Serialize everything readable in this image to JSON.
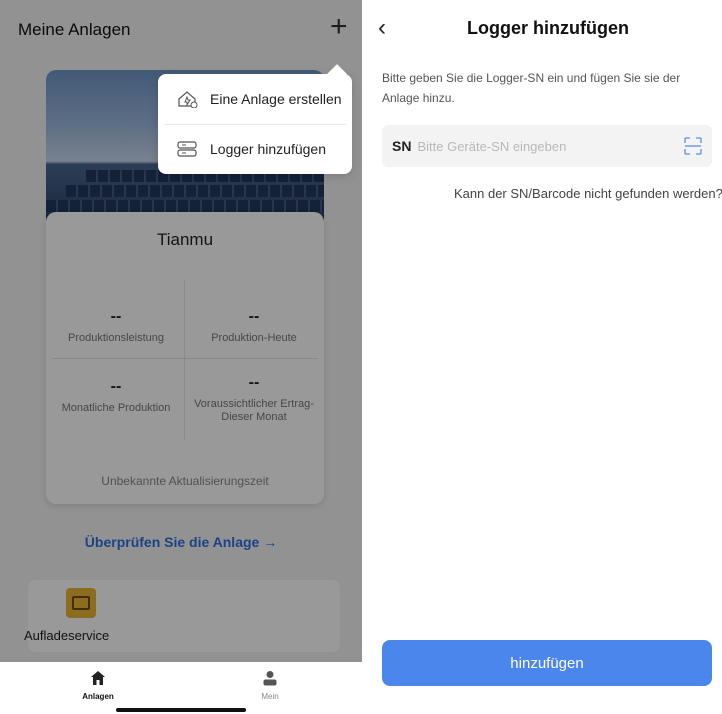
{
  "left": {
    "header_title": "Meine Anlagen",
    "plant_name": "Tianmu",
    "stats": [
      {
        "value": "--",
        "label": "Produktionsleistung"
      },
      {
        "value": "--",
        "label": "Produktion-Heute"
      },
      {
        "value": "--",
        "label": "Monatliche Produktion"
      },
      {
        "value": "--",
        "label": "Voraussichtlicher Ertrag-Dieser Monat"
      }
    ],
    "update_time": "Unbekannte Aktualisierungszeit",
    "check_link": "Überprüfen Sie die Anlage →",
    "service_label": "Aufladeservice",
    "tabs": [
      {
        "label": "Anlagen",
        "active": true
      },
      {
        "label": "Mein",
        "active": false
      }
    ],
    "popup": {
      "items": [
        {
          "label": "Eine Anlage erstellen",
          "icon": "house-add-icon"
        },
        {
          "label": "Logger hinzufügen",
          "icon": "logger-icon"
        }
      ]
    }
  },
  "right": {
    "title": "Logger hinzufügen",
    "description": "Bitte geben Sie die Logger-SN ein und fügen Sie sie der Anlage hinzu.",
    "sn_label": "SN",
    "sn_placeholder": "Bitte Geräte-SN eingeben",
    "sn_value": "",
    "help_link": "Kann der SN/Barcode nicht gefunden werden?",
    "add_button": "hinzufügen"
  },
  "colors": {
    "accent": "#4a86ec",
    "link": "#2f6fe0",
    "service_icon": "#e9b632"
  }
}
